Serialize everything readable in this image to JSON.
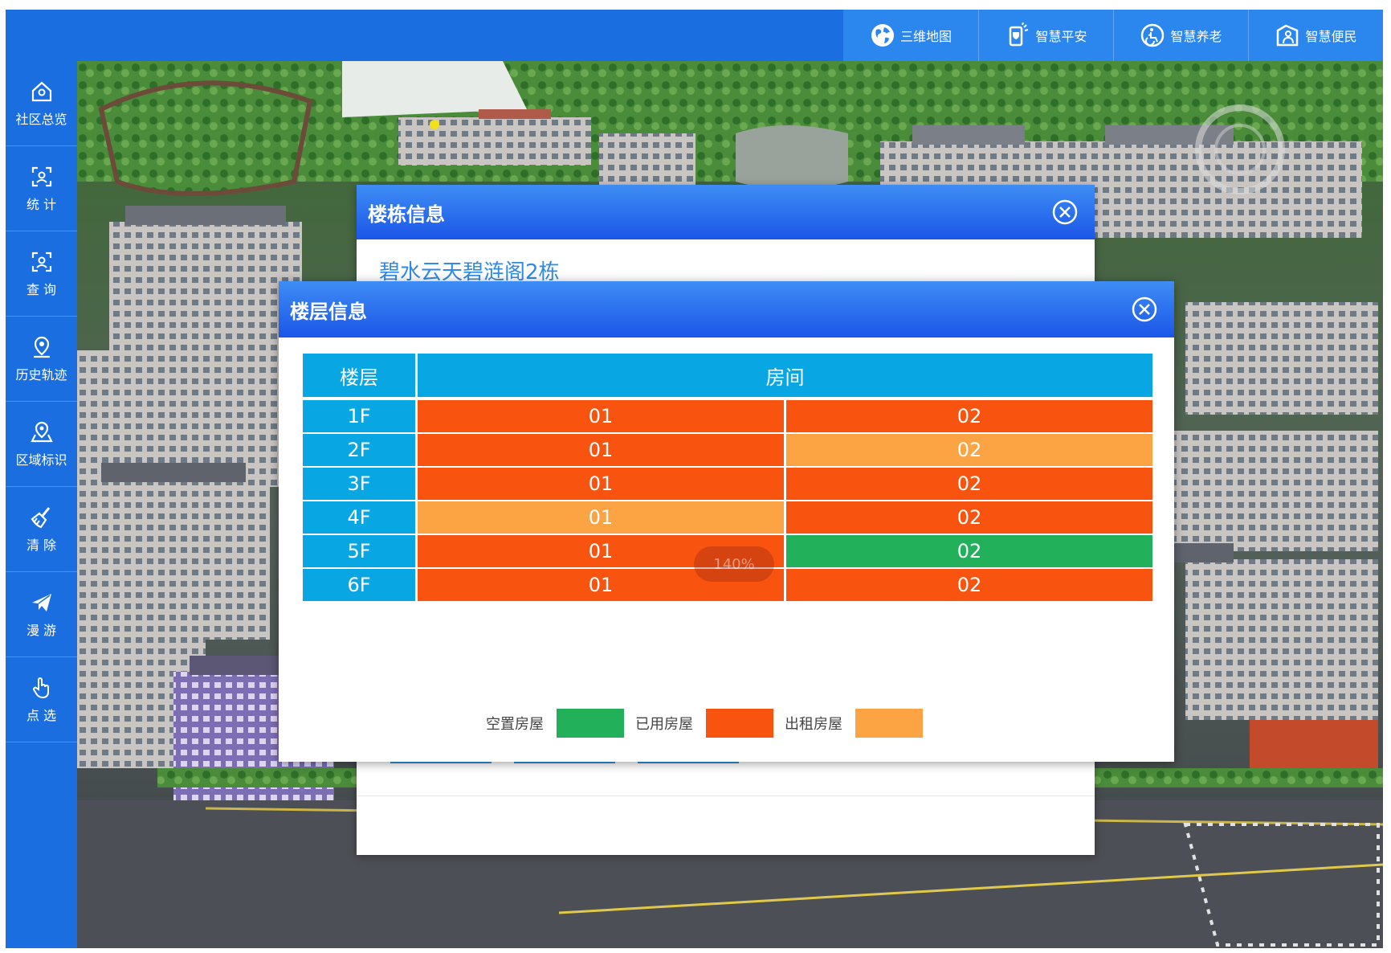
{
  "topnav": [
    {
      "label": "三维地图",
      "icon": "globe-icon"
    },
    {
      "label": "智慧平安",
      "icon": "safety-phone-icon"
    },
    {
      "label": "智慧养老",
      "icon": "elderly-care-icon"
    },
    {
      "label": "智慧便民",
      "icon": "convenience-icon"
    }
  ],
  "sidebar": [
    {
      "label": "社区总览",
      "icon": "home-icon"
    },
    {
      "label": "统 计",
      "icon": "statistics-icon"
    },
    {
      "label": "查 询",
      "icon": "query-icon"
    },
    {
      "label": "历史轨迹",
      "icon": "location-pin-icon"
    },
    {
      "label": "区域标识",
      "icon": "area-marker-icon"
    },
    {
      "label": "清 除",
      "icon": "broom-icon"
    },
    {
      "label": "漫 游",
      "icon": "paper-plane-icon"
    },
    {
      "label": "点 选",
      "icon": "pointer-hand-icon"
    }
  ],
  "building_panel": {
    "title": "楼栋信息",
    "building_name": "碧水云天碧涟阁2栋"
  },
  "floor_panel": {
    "title": "楼层信息",
    "headers": {
      "floor": "楼层",
      "room": "房间"
    },
    "rows": [
      {
        "floor": "1F",
        "rooms": [
          {
            "no": "01",
            "status": "used"
          },
          {
            "no": "02",
            "status": "used"
          }
        ]
      },
      {
        "floor": "2F",
        "rooms": [
          {
            "no": "01",
            "status": "used"
          },
          {
            "no": "02",
            "status": "rented"
          }
        ]
      },
      {
        "floor": "3F",
        "rooms": [
          {
            "no": "01",
            "status": "used"
          },
          {
            "no": "02",
            "status": "used"
          }
        ]
      },
      {
        "floor": "4F",
        "rooms": [
          {
            "no": "01",
            "status": "rented"
          },
          {
            "no": "02",
            "status": "used"
          }
        ]
      },
      {
        "floor": "5F",
        "rooms": [
          {
            "no": "01",
            "status": "used"
          },
          {
            "no": "02",
            "status": "vacant"
          }
        ]
      },
      {
        "floor": "6F",
        "rooms": [
          {
            "no": "01",
            "status": "used"
          },
          {
            "no": "02",
            "status": "used"
          }
        ]
      }
    ],
    "zoom": "140%",
    "legend": [
      {
        "label": "空置房屋",
        "status": "vacant"
      },
      {
        "label": "已用房屋",
        "status": "used"
      },
      {
        "label": "出租房屋",
        "status": "rented"
      }
    ]
  },
  "colors": {
    "vacant": "#22b05a",
    "used": "#f8540f",
    "rented": "#fca344",
    "header_cell": "#09a6e4",
    "nav_blue": "#1a6ee0"
  }
}
